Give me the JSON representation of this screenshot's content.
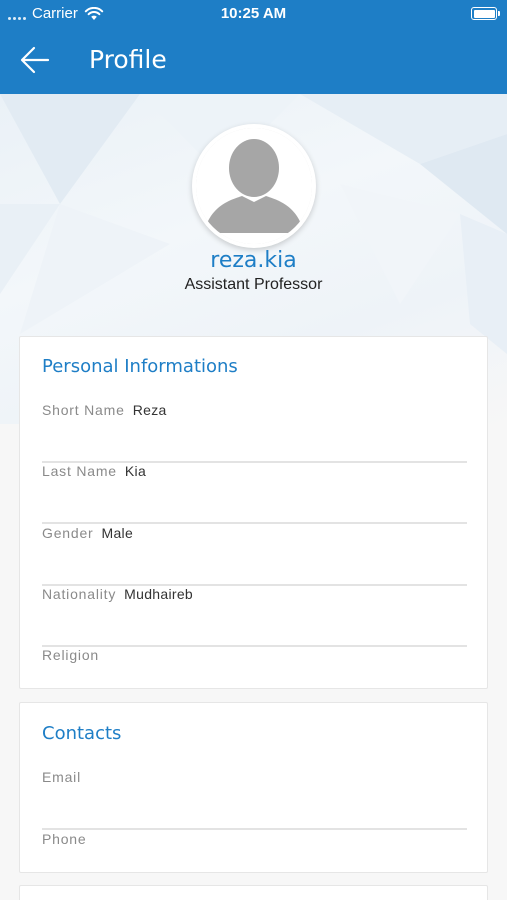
{
  "status_bar": {
    "carrier": "Carrier",
    "time": "10:25 AM"
  },
  "header": {
    "title": "Profile",
    "background": "#1e7ec6",
    "back_icon": "arrow-left-icon"
  },
  "profile": {
    "username": "reza.kia",
    "role": "Assistant Professor",
    "avatar_icon": "user-silhouette-icon"
  },
  "personal": {
    "title": "Personal Informations",
    "fields": [
      {
        "label": "Short Name",
        "value": "Reza"
      },
      {
        "label": "Last Name",
        "value": "Kia"
      },
      {
        "label": "Gender",
        "value": "Male"
      },
      {
        "label": "Nationality",
        "value": "Mudhaireb"
      },
      {
        "label": "Religion",
        "value": ""
      }
    ]
  },
  "contacts": {
    "title": "Contacts",
    "fields": [
      {
        "label": "Email",
        "value": ""
      },
      {
        "label": "Phone",
        "value": ""
      }
    ]
  },
  "colors": {
    "accent": "#1e7ec6",
    "label": "#8a8a8a",
    "divider": "#e3e3e3"
  }
}
